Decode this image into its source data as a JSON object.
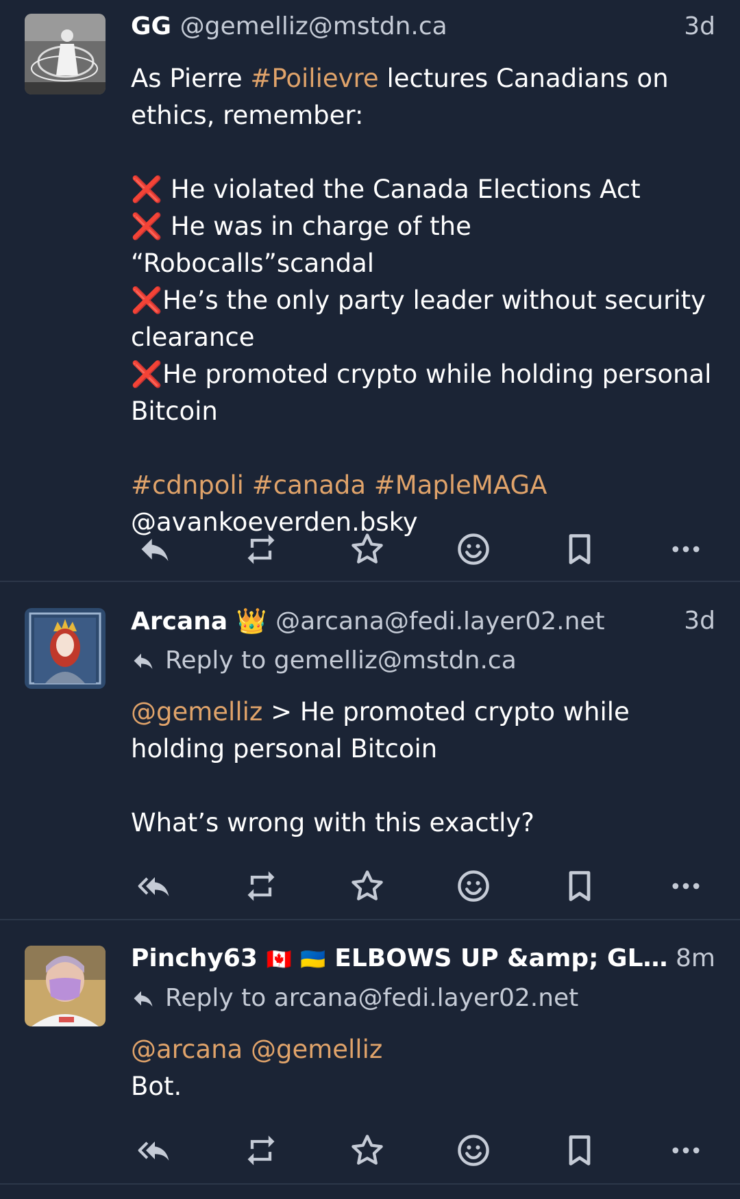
{
  "posts": [
    {
      "display_name": "GG",
      "handle": "@gemelliz@mstdn.ca",
      "time": "3d",
      "avatar_desc": "black-and-white photo avatar",
      "content": {
        "l1_a": "As Pierre ",
        "l1_tag": "#Poilievre",
        "l1_b": " lectures Canadians on",
        "l2": "ethics, remember:",
        "items": [
          "❌ He violated the Canada Elections Act",
          "❌ He was in charge of the “Robocalls”scandal",
          "❌He’s the only party leader without security",
          "clearance",
          "❌He promoted crypto while holding personal",
          "Bitcoin"
        ],
        "tags": "#cdnpoli #canada #MapleMAGA",
        "mention": "@avankoeverden.bsky"
      }
    },
    {
      "display_name": "Arcana",
      "name_emoji": "👑",
      "handle": "@arcana@fedi.layer02.net",
      "time": "3d",
      "reply_to": "Reply to gemelliz@mstdn.ca",
      "content": {
        "mention": "@gemelliz",
        "l1": " > He promoted crypto while",
        "l2": "holding personal Bitcoin",
        "l3": "What’s wrong with this exactly?"
      }
    },
    {
      "display_name": "Pinchy63",
      "flag1": "🇨🇦",
      "flag2": "🇺🇦",
      "name_rest": "ELBOWS UP &amp; GL…",
      "time": "8m",
      "reply_to": "Reply to arcana@fedi.layer02.net",
      "content": {
        "mentions": "@arcana @gemelliz",
        "l1": "Bot."
      }
    }
  ],
  "icons": [
    "reply-icon",
    "reply-all-icon",
    "boost-icon",
    "favourite-icon",
    "emoji-react-icon",
    "bookmark-icon",
    "more-icon"
  ],
  "colors": {
    "background": "#1b2435",
    "hashtag": "#e0a36a",
    "muted": "#c5cbd6",
    "icon": "#c5cbd6"
  }
}
